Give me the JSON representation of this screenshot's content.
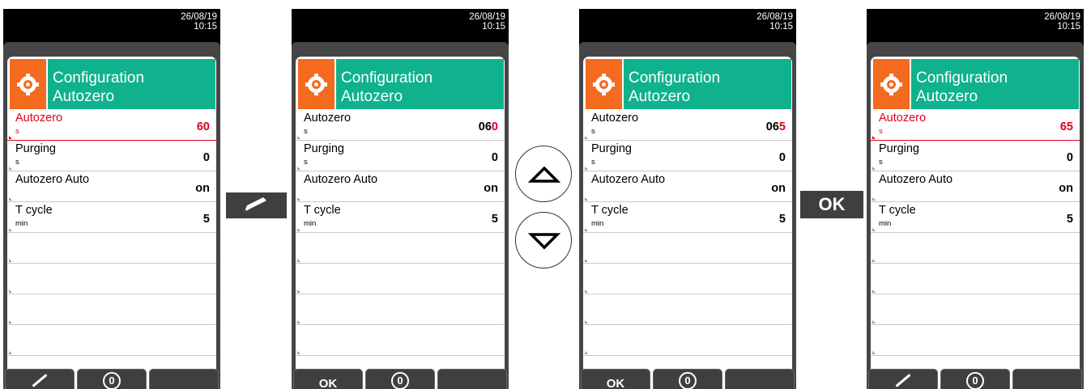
{
  "screens": [
    {
      "date": "26/08/19",
      "time": "10:15",
      "header": {
        "line1": "Configuration",
        "line2": "Autozero"
      },
      "rows": [
        {
          "label": "Autozero",
          "unit": "s",
          "value": "60",
          "value_red": "",
          "active": true
        },
        {
          "label": "Purging",
          "unit": "s",
          "value": "0",
          "value_red": "",
          "active": false
        },
        {
          "label": "Autozero Auto",
          "unit": "",
          "value": "on",
          "value_red": "",
          "active": false
        },
        {
          "label": "T cycle",
          "unit": "min",
          "value": "5",
          "value_red": "",
          "active": false
        }
      ],
      "softkeys": [
        "edit",
        "zero",
        ""
      ]
    },
    {
      "date": "26/08/19",
      "time": "10:15",
      "header": {
        "line1": "Configuration",
        "line2": "Autozero"
      },
      "rows": [
        {
          "label": "Autozero",
          "unit": "s",
          "value": "06",
          "value_red": "0",
          "active": false
        },
        {
          "label": "Purging",
          "unit": "s",
          "value": "0",
          "value_red": "",
          "active": false
        },
        {
          "label": "Autozero Auto",
          "unit": "",
          "value": "on",
          "value_red": "",
          "active": false
        },
        {
          "label": "T cycle",
          "unit": "min",
          "value": "5",
          "value_red": "",
          "active": false
        }
      ],
      "softkeys": [
        "OK",
        "zero",
        ""
      ]
    },
    {
      "date": "26/08/19",
      "time": "10:15",
      "header": {
        "line1": "Configuration",
        "line2": "Autozero"
      },
      "rows": [
        {
          "label": "Autozero",
          "unit": "s",
          "value": "06",
          "value_red": "5",
          "active": false
        },
        {
          "label": "Purging",
          "unit": "s",
          "value": "0",
          "value_red": "",
          "active": false
        },
        {
          "label": "Autozero Auto",
          "unit": "",
          "value": "on",
          "value_red": "",
          "active": false
        },
        {
          "label": "T cycle",
          "unit": "min",
          "value": "5",
          "value_red": "",
          "active": false
        }
      ],
      "softkeys": [
        "OK",
        "zero",
        ""
      ]
    },
    {
      "date": "26/08/19",
      "time": "10:15",
      "header": {
        "line1": "Configuration",
        "line2": "Autozero"
      },
      "rows": [
        {
          "label": "Autozero",
          "unit": "s",
          "value": "65",
          "value_red": "",
          "active": true
        },
        {
          "label": "Purging",
          "unit": "s",
          "value": "0",
          "value_red": "",
          "active": false
        },
        {
          "label": "Autozero Auto",
          "unit": "",
          "value": "on",
          "value_red": "",
          "active": false
        },
        {
          "label": "T cycle",
          "unit": "min",
          "value": "5",
          "value_red": "",
          "active": false
        }
      ],
      "softkeys": [
        "edit",
        "zero",
        ""
      ]
    }
  ],
  "empty_rows": 4,
  "between_keys": {
    "edit_icon": "pencil-icon",
    "up_icon": "arrow-up-icon",
    "down_icon": "arrow-down-icon",
    "ok_label": "OK"
  },
  "colors": {
    "header_teal": "#0fb28d",
    "icon_orange": "#f46a1f",
    "active_red": "#e0001b"
  }
}
